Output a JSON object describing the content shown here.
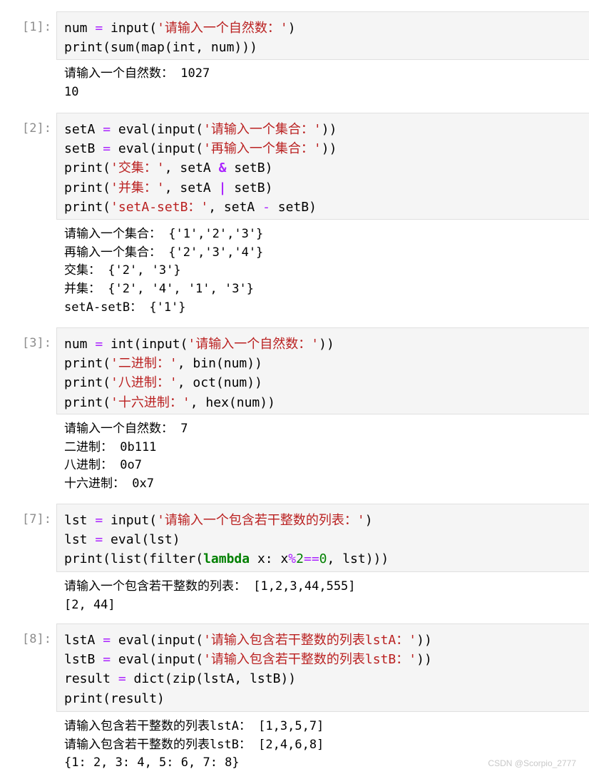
{
  "cells": [
    {
      "prompt": "[1]:",
      "code": [
        [
          [
            "t",
            "num "
          ],
          [
            "op",
            "="
          ],
          [
            "t",
            " input("
          ],
          [
            "s",
            "'请输入一个自然数：'"
          ],
          [
            "t",
            ")"
          ]
        ],
        [
          [
            "t",
            "print(sum(map(int, num)))"
          ]
        ]
      ],
      "output": [
        "请输入一个自然数： 1027",
        "10"
      ]
    },
    {
      "prompt": "[2]:",
      "code": [
        [
          [
            "t",
            "setA "
          ],
          [
            "op",
            "="
          ],
          [
            "t",
            " eval(input("
          ],
          [
            "s",
            "'请输入一个集合：'"
          ],
          [
            "t",
            "))"
          ]
        ],
        [
          [
            "t",
            "setB "
          ],
          [
            "op",
            "="
          ],
          [
            "t",
            " eval(input("
          ],
          [
            "s",
            "'再输入一个集合：'"
          ],
          [
            "t",
            "))"
          ]
        ],
        [
          [
            "t",
            "print("
          ],
          [
            "s",
            "'交集：'"
          ],
          [
            "t",
            ", setA "
          ],
          [
            "o",
            "&"
          ],
          [
            "t",
            " setB)"
          ]
        ],
        [
          [
            "t",
            "print("
          ],
          [
            "s",
            "'并集：'"
          ],
          [
            "t",
            ", setA "
          ],
          [
            "o",
            "|"
          ],
          [
            "t",
            " setB)"
          ]
        ],
        [
          [
            "t",
            "print("
          ],
          [
            "s",
            "'setA-setB：'"
          ],
          [
            "t",
            ", setA "
          ],
          [
            "op",
            "-"
          ],
          [
            "t",
            " setB)"
          ]
        ]
      ],
      "output": [
        "请输入一个集合： {'1','2','3'}",
        "再输入一个集合： {'2','3','4'}",
        "交集： {'2', '3'}",
        "并集： {'2', '4', '1', '3'}",
        "setA-setB： {'1'}"
      ]
    },
    {
      "prompt": "[3]:",
      "code": [
        [
          [
            "t",
            "num "
          ],
          [
            "op",
            "="
          ],
          [
            "t",
            " int(input("
          ],
          [
            "s",
            "'请输入一个自然数：'"
          ],
          [
            "t",
            "))"
          ]
        ],
        [
          [
            "t",
            "print("
          ],
          [
            "s",
            "'二进制：'"
          ],
          [
            "t",
            ", bin(num))"
          ]
        ],
        [
          [
            "t",
            "print("
          ],
          [
            "s",
            "'八进制：'"
          ],
          [
            "t",
            ", oct(num))"
          ]
        ],
        [
          [
            "t",
            "print("
          ],
          [
            "s",
            "'十六进制：'"
          ],
          [
            "t",
            ", hex(num))"
          ]
        ]
      ],
      "output": [
        "请输入一个自然数： 7",
        "二进制： 0b111",
        "八进制： 0o7",
        "十六进制： 0x7"
      ]
    },
    {
      "prompt": "[7]:",
      "code": [
        [
          [
            "t",
            "lst "
          ],
          [
            "op",
            "="
          ],
          [
            "t",
            " input("
          ],
          [
            "s",
            "'请输入一个包含若干整数的列表：'"
          ],
          [
            "t",
            ")"
          ]
        ],
        [
          [
            "t",
            "lst "
          ],
          [
            "op",
            "="
          ],
          [
            "t",
            " eval(lst)"
          ]
        ],
        [
          [
            "t",
            "print(list(filter("
          ],
          [
            "k",
            "lambda"
          ],
          [
            "t",
            " x: x"
          ],
          [
            "op",
            "%"
          ],
          [
            "n",
            "2"
          ],
          [
            "op",
            "=="
          ],
          [
            "n",
            "0"
          ],
          [
            "t",
            ", lst)))"
          ]
        ]
      ],
      "output": [
        "请输入一个包含若干整数的列表： [1,2,3,44,555]",
        "[2, 44]"
      ]
    },
    {
      "prompt": "[8]:",
      "code": [
        [
          [
            "t",
            "lstA "
          ],
          [
            "op",
            "="
          ],
          [
            "t",
            " eval(input("
          ],
          [
            "s",
            "'请输入包含若干整数的列表lstA：'"
          ],
          [
            "t",
            "))"
          ]
        ],
        [
          [
            "t",
            "lstB "
          ],
          [
            "op",
            "="
          ],
          [
            "t",
            " eval(input("
          ],
          [
            "s",
            "'请输入包含若干整数的列表lstB：'"
          ],
          [
            "t",
            "))"
          ]
        ],
        [
          [
            "t",
            "result "
          ],
          [
            "op",
            "="
          ],
          [
            "t",
            " dict(zip(lstA, lstB))"
          ]
        ],
        [
          [
            "t",
            "print(result)"
          ]
        ]
      ],
      "output": [
        "请输入包含若干整数的列表lstA： [1,3,5,7]",
        "请输入包含若干整数的列表lstB： [2,4,6,8]",
        "{1: 2, 3: 4, 5: 6, 7: 8}"
      ]
    }
  ],
  "watermark": "CSDN @Scorpio_2777"
}
